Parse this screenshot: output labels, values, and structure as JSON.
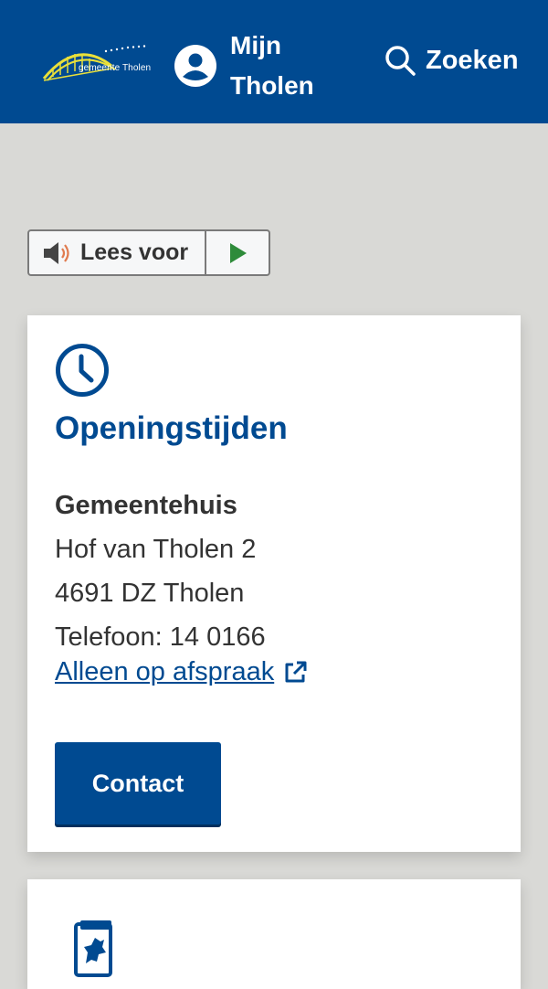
{
  "header": {
    "logo_text": "gemeente Tholen",
    "account_label": "Mijn Tholen",
    "search_label": "Zoeken",
    "colors": {
      "background": "#004a91",
      "text": "#ffffff",
      "logo_arc": "#e9e03a"
    }
  },
  "readspeaker": {
    "label": "Lees voor",
    "speaker_icon": "speaker-icon",
    "play_icon": "play-icon"
  },
  "card_hours": {
    "icon": "clock-icon",
    "title": "Openingstijden",
    "location_name": "Gemeentehuis",
    "street": "Hof van Tholen 2",
    "postal": "4691 DZ Tholen",
    "phone": "Telefoon: 14 0166",
    "appointment_link": "Alleen op afspraak",
    "contact_button": "Contact"
  },
  "card_next": {
    "icon": "document-icon"
  },
  "colors": {
    "primary": "#004a91",
    "page_background": "#d9d9d6",
    "card_background": "#ffffff",
    "play_green": "#2e8b3a"
  }
}
